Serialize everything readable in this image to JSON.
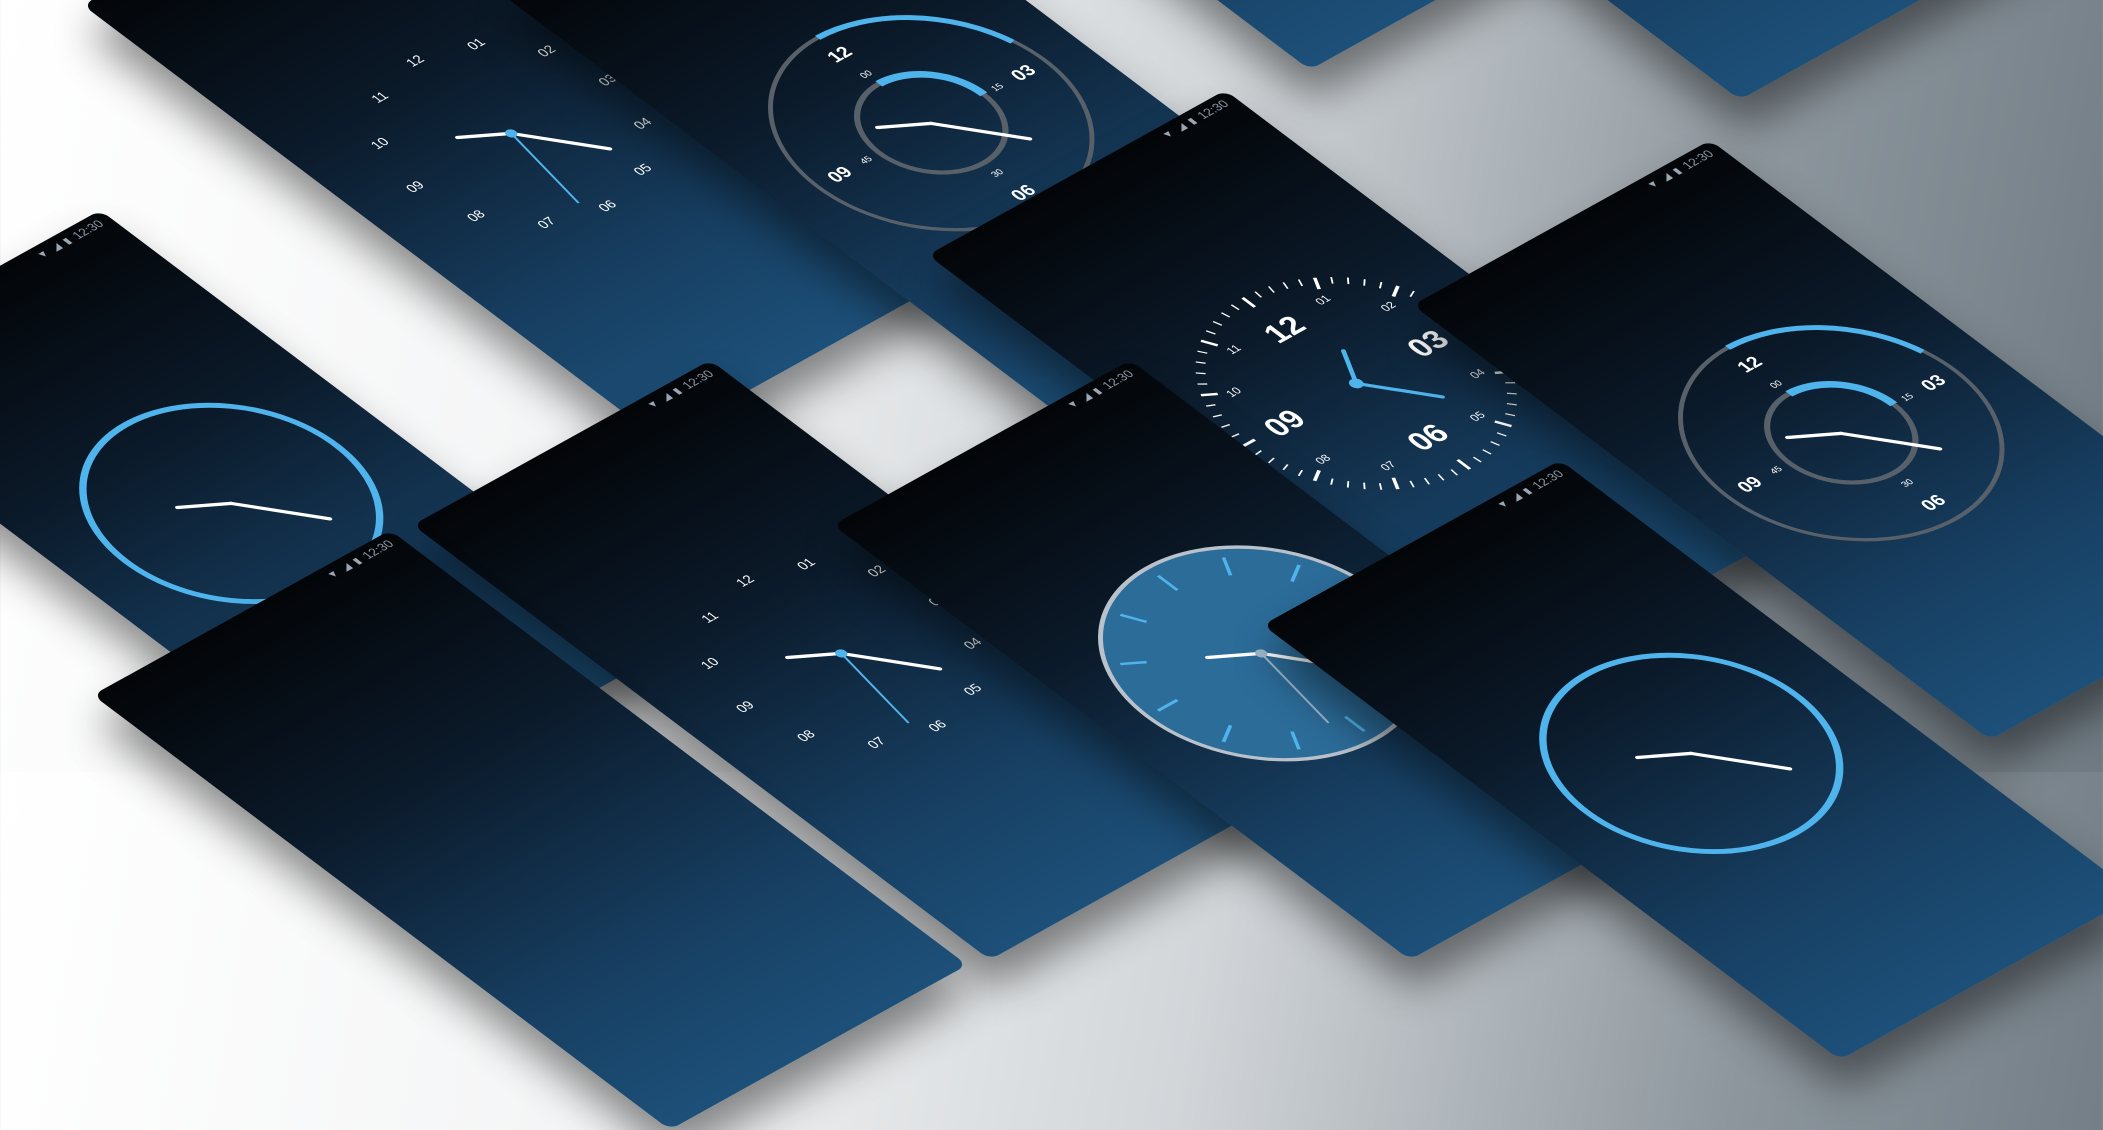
{
  "status": {
    "time": "12:30"
  },
  "colors": {
    "accent": "#4fb3ec",
    "hand": "#ffffff",
    "ring": "#58616a"
  },
  "icons": {
    "wifi": "wifi-icon",
    "signal": "signal-icon",
    "battery": "battery-icon"
  },
  "dial_hours": [
    "12",
    "01",
    "02",
    "03",
    "04",
    "05",
    "06",
    "07",
    "08",
    "09",
    "10",
    "11"
  ],
  "dial_bold": [
    "12",
    "03",
    "06",
    "09"
  ],
  "inner_marks": [
    "00",
    "15",
    "30",
    "45"
  ]
}
